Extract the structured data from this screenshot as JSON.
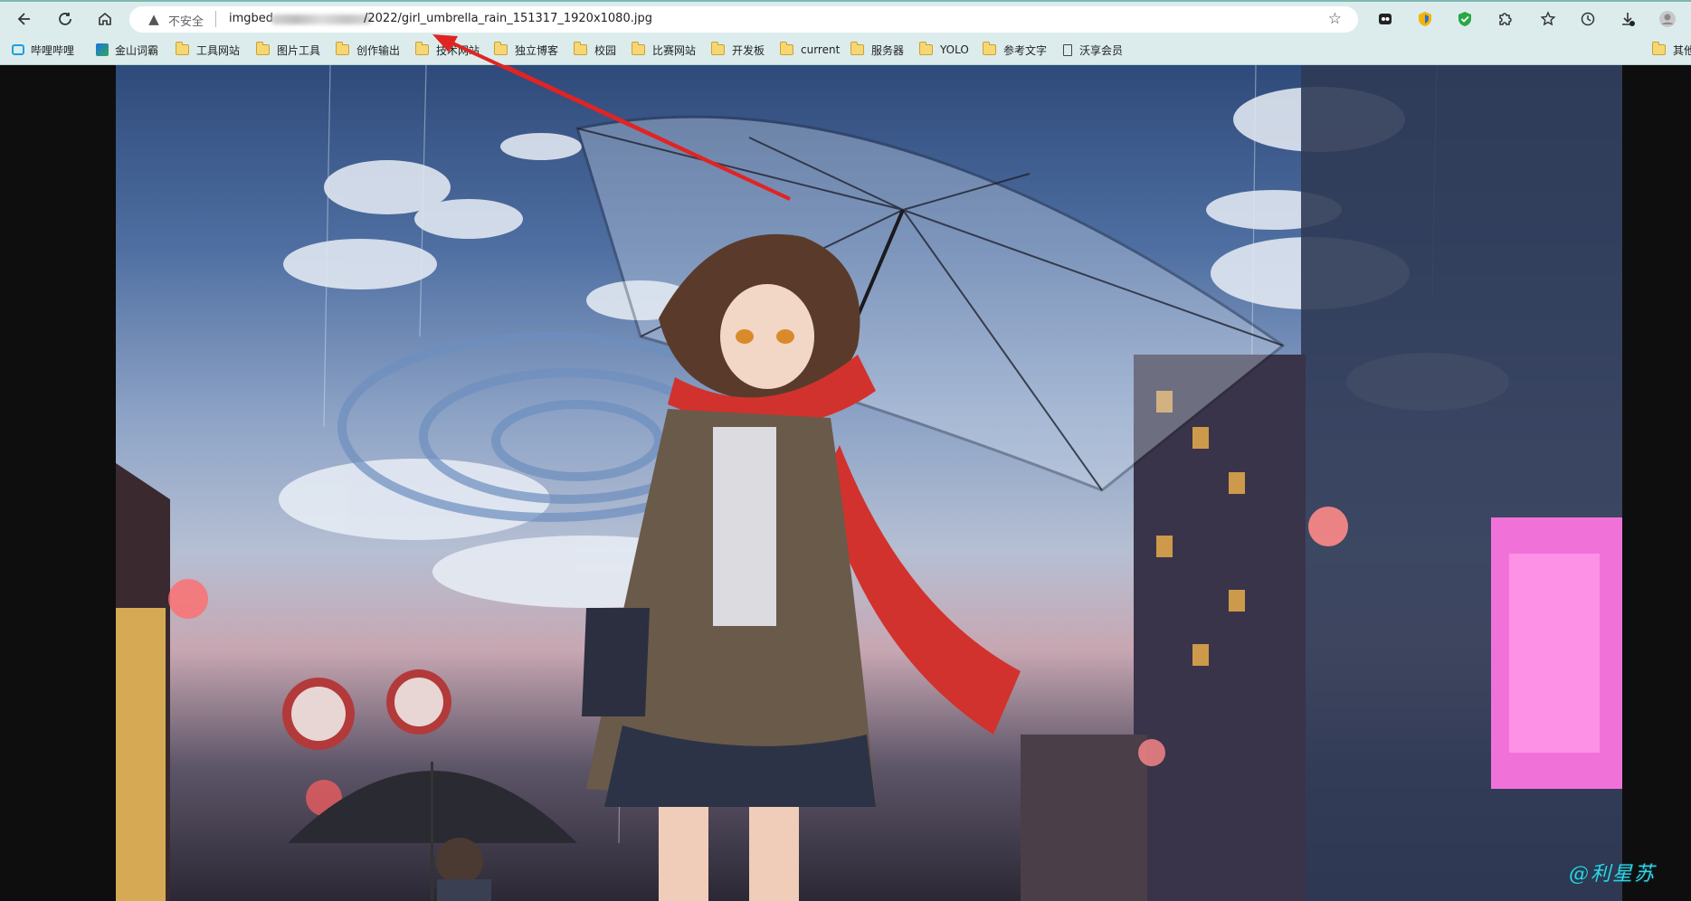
{
  "browser": {
    "security_label": "不安全",
    "url_host_visible": "imgbed",
    "url_path_visible": "/2022/girl_umbrella_rain_151317_1920x1080.jpg",
    "icons": {
      "back": "arrow-left-icon",
      "reload": "reload-icon",
      "home": "home-icon",
      "warning": "warning-triangle-icon",
      "favorite": "star-add-icon",
      "ext1": "ghost-extension-icon",
      "ext2": "shield-extension-icon",
      "ext3": "green-shield-extension-icon",
      "extensions": "puzzle-icon",
      "favorites": "favorites-icon",
      "history": "history-icon",
      "downloads": "download-icon",
      "profile": "avatar-icon"
    }
  },
  "bookmarks": [
    {
      "label": "哔哩哔哩",
      "icon": "bilibili-icon"
    },
    {
      "label": "金山词霸",
      "icon": "jinshan-icon"
    },
    {
      "label": "工具网站",
      "icon": "folder-icon"
    },
    {
      "label": "图片工具",
      "icon": "folder-icon"
    },
    {
      "label": "创作输出",
      "icon": "folder-icon"
    },
    {
      "label": "技术网站",
      "icon": "folder-icon"
    },
    {
      "label": "独立博客",
      "icon": "folder-icon"
    },
    {
      "label": "校园",
      "icon": "folder-icon"
    },
    {
      "label": "比赛网站",
      "icon": "folder-icon"
    },
    {
      "label": "开发板",
      "icon": "folder-icon"
    },
    {
      "label": "current",
      "icon": "folder-icon"
    },
    {
      "label": "服务器",
      "icon": "folder-icon"
    },
    {
      "label": "YOLO",
      "icon": "folder-icon"
    },
    {
      "label": "参考文字",
      "icon": "folder-icon"
    },
    {
      "label": "沃享会员",
      "icon": "document-icon"
    },
    {
      "label": "其他",
      "icon": "folder-icon"
    }
  ],
  "image": {
    "subject": "anime girl with transparent umbrella in rain"
  },
  "watermark_text": "@利星苏",
  "colors": {
    "toolbar_bg": "#dcecec",
    "annotation_arrow": "#e02424",
    "watermark": "#31d4e6"
  }
}
